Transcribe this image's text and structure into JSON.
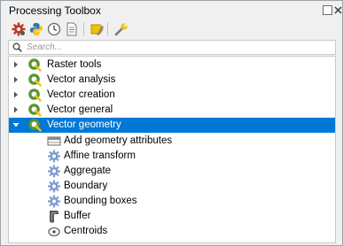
{
  "window": {
    "title": "Processing Toolbox"
  },
  "toolbar": {
    "buttons": [
      {
        "icon": "models-gear-icon"
      },
      {
        "icon": "python-icon"
      },
      {
        "icon": "history-clock-icon"
      },
      {
        "icon": "results-document-icon"
      },
      {
        "icon": "edit-in-place-icon"
      },
      {
        "icon": "options-wrench-icon"
      }
    ]
  },
  "search": {
    "placeholder": "Search..."
  },
  "tree": {
    "categories": [
      {
        "label": "Raster tools",
        "expanded": false
      },
      {
        "label": "Vector analysis",
        "expanded": false
      },
      {
        "label": "Vector creation",
        "expanded": false
      },
      {
        "label": "Vector general",
        "expanded": false
      },
      {
        "label": "Vector geometry",
        "expanded": true,
        "selected": true
      }
    ],
    "algorithms": [
      {
        "label": "Add geometry attributes",
        "icon": "table-icon"
      },
      {
        "label": "Affine transform",
        "icon": "gear-icon"
      },
      {
        "label": "Aggregate",
        "icon": "gear-icon"
      },
      {
        "label": "Boundary",
        "icon": "gear-icon"
      },
      {
        "label": "Bounding boxes",
        "icon": "gear-icon"
      },
      {
        "label": "Buffer",
        "icon": "buffer-icon"
      },
      {
        "label": "Centroids",
        "icon": "centroid-icon"
      }
    ]
  },
  "colors": {
    "selection": "#0078d7",
    "qgis_green": "#589632",
    "gear_blue": "#7d9fd0"
  }
}
